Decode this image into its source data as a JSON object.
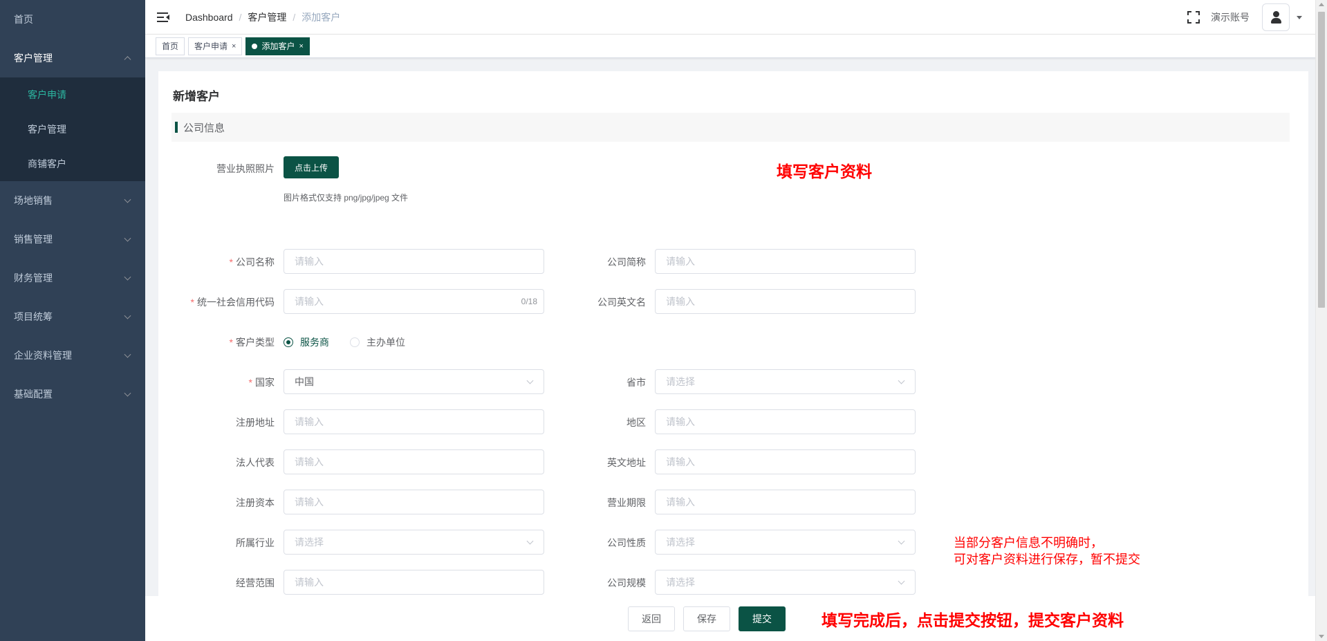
{
  "sidebar": {
    "home": "首页",
    "customer_mgmt": "客户管理",
    "sub_items": [
      "客户申请",
      "客户管理",
      "商铺客户"
    ],
    "menus": [
      "场地销售",
      "销售管理",
      "财务管理",
      "项目统筹",
      "企业资料管理",
      "基础配置"
    ]
  },
  "navbar": {
    "breadcrumb": [
      "Dashboard",
      "客户管理",
      "添加客户"
    ],
    "account": "演示账号"
  },
  "tags": {
    "home": "首页",
    "apply": "客户申请",
    "add": "添加客户",
    "close": "×"
  },
  "form": {
    "title": "新增客户",
    "section": "公司信息",
    "license_label": "营业执照照片",
    "upload_btn": "点击上传",
    "upload_tip": "图片格式仅支持 png/jpg/jpeg 文件",
    "required_mark": "*",
    "company_name": {
      "label": "公司名称",
      "placeholder": "请输入"
    },
    "company_short": {
      "label": "公司简称",
      "placeholder": "请输入"
    },
    "credit_code": {
      "label": "统一社会信用代码",
      "placeholder": "请输入",
      "counter": "0/18"
    },
    "english_name": {
      "label": "公司英文名",
      "placeholder": "请输入"
    },
    "customer_type": {
      "label": "客户类型",
      "options": [
        "服务商",
        "主办单位"
      ],
      "selected": "服务商"
    },
    "country": {
      "label": "国家",
      "value": "中国"
    },
    "province": {
      "label": "省市",
      "placeholder": "请选择"
    },
    "reg_address": {
      "label": "注册地址",
      "placeholder": "请输入"
    },
    "region": {
      "label": "地区",
      "placeholder": "请输入"
    },
    "legal_rep": {
      "label": "法人代表",
      "placeholder": "请输入"
    },
    "en_address": {
      "label": "英文地址",
      "placeholder": "请输入"
    },
    "reg_capital": {
      "label": "注册资本",
      "placeholder": "请输入"
    },
    "biz_term": {
      "label": "营业期限",
      "placeholder": "请输入"
    },
    "industry": {
      "label": "所属行业",
      "placeholder": "请选择"
    },
    "nature": {
      "label": "公司性质",
      "placeholder": "请选择"
    },
    "scope": {
      "label": "经营范围",
      "placeholder": "请输入"
    },
    "scale": {
      "label": "公司规模",
      "placeholder": "请选择"
    }
  },
  "annotations": {
    "fill": "填写客户资料",
    "save_line1": "当部分客户信息不明确时，",
    "save_line2": "可对客户资料进行保存，暂不提交",
    "submit": "填写完成后，点击提交按钮，提交客户资料"
  },
  "footer": {
    "back": "返回",
    "save": "保存",
    "submit": "提交"
  },
  "colors": {
    "sidebar_bg": "#304156",
    "submenu_bg": "#1f2d3d",
    "active_submenu": "#2bb5a0",
    "primary": "#0b5345",
    "required": "#f56c6c",
    "annotation": "#ff0000"
  }
}
